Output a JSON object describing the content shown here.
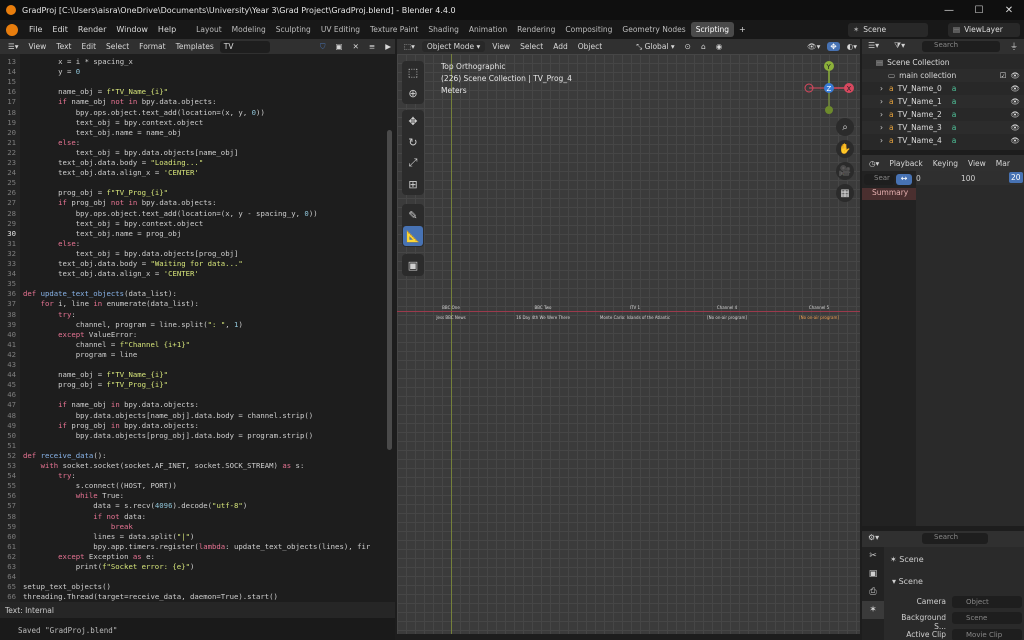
{
  "window": {
    "title": "GradProj [C:\\Users\\aisra\\OneDrive\\Documents\\University\\Year 3\\Grad Project\\GradProj.blend] - Blender 4.4.0"
  },
  "menu": [
    "File",
    "Edit",
    "Render",
    "Window",
    "Help"
  ],
  "workspaces": [
    "Layout",
    "Modeling",
    "Sculpting",
    "UV Editing",
    "Texture Paint",
    "Shading",
    "Animation",
    "Rendering",
    "Compositing",
    "Geometry Nodes",
    "Scripting"
  ],
  "scene_name": "Scene",
  "view_layer": "ViewLayer",
  "text_editor": {
    "menus": [
      "View",
      "Text",
      "Edit",
      "Select",
      "Format",
      "Templates"
    ],
    "text_name": "TV",
    "footer": "Text: Internal",
    "current_line": 30,
    "lines": [
      {
        "n": "13",
        "code": "        x = i * spacing_x"
      },
      {
        "n": "14",
        "code": "        y = 0"
      },
      {
        "n": "15",
        "code": ""
      },
      {
        "n": "16",
        "code": "        name_obj = f\"TV_Name_{i}\""
      },
      {
        "n": "17",
        "code": "        if name_obj not in bpy.data.objects:"
      },
      {
        "n": "18",
        "code": "            bpy.ops.object.text_add(location=(x, y, 0))"
      },
      {
        "n": "19",
        "code": "            text_obj = bpy.context.object"
      },
      {
        "n": "20",
        "code": "            text_obj.name = name_obj"
      },
      {
        "n": "21",
        "code": "        else:"
      },
      {
        "n": "22",
        "code": "            text_obj = bpy.data.objects[name_obj]"
      },
      {
        "n": "23",
        "code": "        text_obj.data.body = \"Loading...\""
      },
      {
        "n": "24",
        "code": "        text_obj.data.align_x = 'CENTER'"
      },
      {
        "n": "25",
        "code": ""
      },
      {
        "n": "26",
        "code": "        prog_obj = f\"TV_Prog_{i}\""
      },
      {
        "n": "27",
        "code": "        if prog_obj not in bpy.data.objects:"
      },
      {
        "n": "28",
        "code": "            bpy.ops.object.text_add(location=(x, y - spacing_y, 0))"
      },
      {
        "n": "29",
        "code": "            text_obj = bpy.context.object"
      },
      {
        "n": "30",
        "code": "            text_obj.name = prog_obj"
      },
      {
        "n": "31",
        "code": "        else:"
      },
      {
        "n": "32",
        "code": "            text_obj = bpy.data.objects[prog_obj]"
      },
      {
        "n": "33",
        "code": "        text_obj.data.body = \"Waiting for data...\""
      },
      {
        "n": "34",
        "code": "        text_obj.data.align_x = 'CENTER'"
      },
      {
        "n": "35",
        "code": ""
      },
      {
        "n": "36",
        "code": "def update_text_objects(data_list):"
      },
      {
        "n": "37",
        "code": "    for i, line in enumerate(data_list):"
      },
      {
        "n": "38",
        "code": "        try:"
      },
      {
        "n": "39",
        "code": "            channel, program = line.split(\": \", 1)"
      },
      {
        "n": "40",
        "code": "        except ValueError:"
      },
      {
        "n": "41",
        "code": "            channel = f\"Channel {i+1}\""
      },
      {
        "n": "42",
        "code": "            program = line"
      },
      {
        "n": "43",
        "code": ""
      },
      {
        "n": "44",
        "code": "        name_obj = f\"TV_Name_{i}\""
      },
      {
        "n": "45",
        "code": "        prog_obj = f\"TV_Prog_{i}\""
      },
      {
        "n": "46",
        "code": ""
      },
      {
        "n": "47",
        "code": "        if name_obj in bpy.data.objects:"
      },
      {
        "n": "48",
        "code": "            bpy.data.objects[name_obj].data.body = channel.strip()"
      },
      {
        "n": "49",
        "code": "        if prog_obj in bpy.data.objects:"
      },
      {
        "n": "50",
        "code": "            bpy.data.objects[prog_obj].data.body = program.strip()"
      },
      {
        "n": "51",
        "code": ""
      },
      {
        "n": "52",
        "code": "def receive_data():"
      },
      {
        "n": "53",
        "code": "    with socket.socket(socket.AF_INET, socket.SOCK_STREAM) as s:"
      },
      {
        "n": "54",
        "code": "        try:"
      },
      {
        "n": "55",
        "code": "            s.connect((HOST, PORT))"
      },
      {
        "n": "56",
        "code": "            while True:"
      },
      {
        "n": "57",
        "code": "                data = s.recv(4096).decode(\"utf-8\")"
      },
      {
        "n": "58",
        "code": "                if not data:"
      },
      {
        "n": "59",
        "code": "                    break"
      },
      {
        "n": "60",
        "code": "                lines = data.split(\"|\")"
      },
      {
        "n": "61",
        "code": "                bpy.app.timers.register(lambda: update_text_objects(lines), fir"
      },
      {
        "n": "62",
        "code": "        except Exception as e:"
      },
      {
        "n": "63",
        "code": "            print(f\"Socket error: {e}\")"
      },
      {
        "n": "64",
        "code": ""
      },
      {
        "n": "65",
        "code": "setup_text_objects()"
      },
      {
        "n": "66",
        "code": "threading.Thread(target=receive_data, daemon=True).start()"
      }
    ]
  },
  "status_message": "Saved \"GradProj.blend\"",
  "viewport": {
    "mode": "Object Mode",
    "menus": [
      "View",
      "Select",
      "Add",
      "Object"
    ],
    "orientation": "Global",
    "overlay_lines": [
      "Top Orthographic",
      "(226) Scene Collection | TV_Prog_4",
      "Meters"
    ],
    "channels": [
      "BBC One",
      "BBC Two",
      "ITV 1",
      "Channel 4",
      "Channel 5"
    ],
    "programs": [
      "Jess BBC News",
      "16 Day 4th We Were There",
      "Monte Carlo: Islands of the Atlantic",
      "[No on-air program]",
      "[No on-air program]"
    ]
  },
  "outliner": {
    "search_placeholder": "Search",
    "root": "Scene Collection",
    "collection": "main collection",
    "items": [
      "TV_Name_0",
      "TV_Name_1",
      "TV_Name_2",
      "TV_Name_3",
      "TV_Name_4"
    ]
  },
  "timeline": {
    "menus": [
      "Playback",
      "Keying",
      "View",
      "Mar"
    ],
    "search_placeholder": "Sear",
    "ruler": [
      "0",
      "100",
      "20"
    ],
    "summary": "Summary"
  },
  "properties": {
    "search_placeholder": "Search",
    "scene": "Scene",
    "section": "Scene",
    "camera_label": "Camera",
    "camera_value": "Object",
    "bg_label": "Background S...",
    "bg_value": "Scene",
    "clip_label": "Active Clip",
    "clip_value": "Movie Clip"
  },
  "colors": {
    "accent": "#4772b3",
    "x_axis": "#9a3a4c",
    "y_axis": "#75803a",
    "blender_orange": "#e87d0d"
  }
}
